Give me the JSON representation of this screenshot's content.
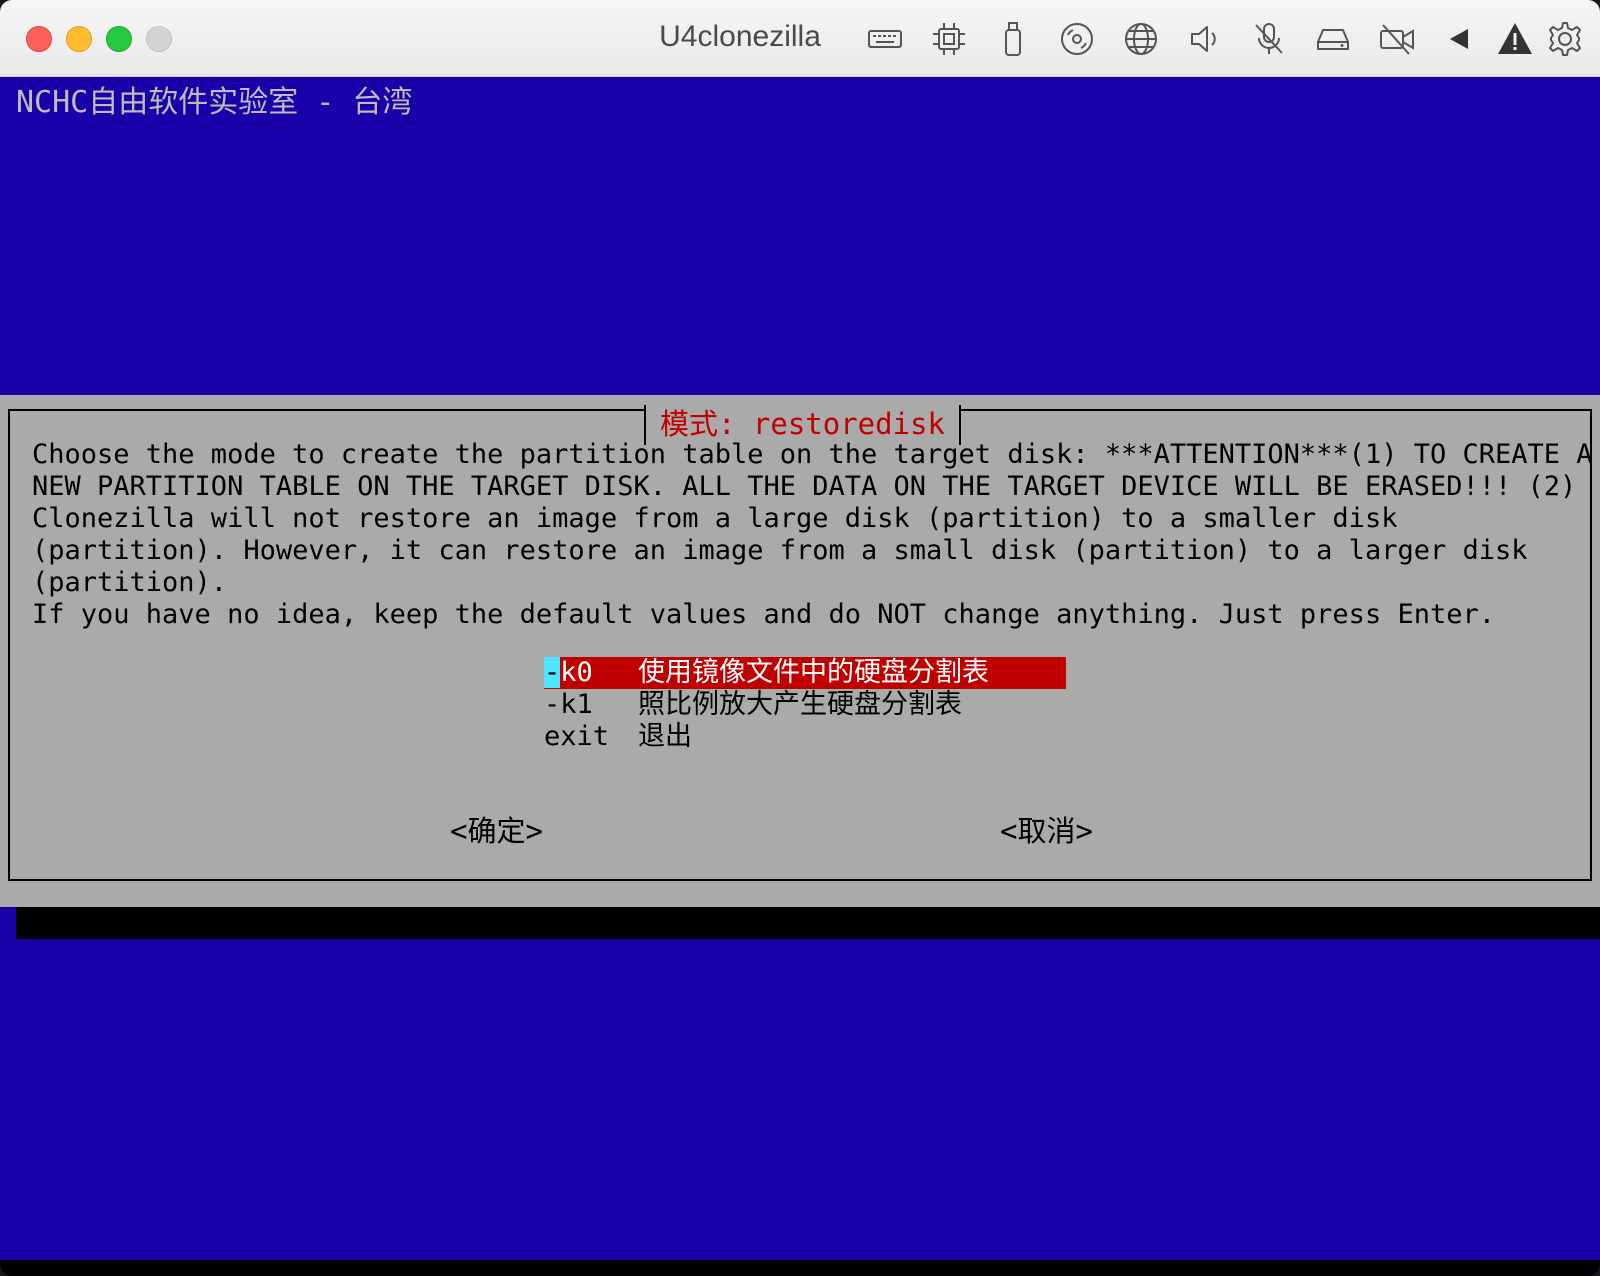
{
  "window": {
    "title": "U4clonezilla",
    "toolbar_icons": [
      "keyboard-icon",
      "cpu-icon",
      "usb-icon",
      "disc-icon",
      "network-icon",
      "speaker-icon",
      "microphone-muted-icon",
      "hard-drive-icon",
      "camera-off-icon",
      "back-arrow-icon",
      "warning-icon",
      "settings-gear-icon"
    ]
  },
  "console": {
    "backtitle": "NCHC自由软件实验室 - 台湾",
    "dialog": {
      "title": "模式: restoredisk",
      "text": "Choose the mode to create the partition table on the target disk: ***ATTENTION***(1) TO CREATE A\nNEW PARTITION TABLE ON THE TARGET DISK. ALL THE DATA ON THE TARGET DEVICE WILL BE ERASED!!! (2)\nClonezilla will not restore an image from a large disk (partition) to a smaller disk\n(partition). However, it can restore an image from a small disk (partition) to a larger disk\n(partition).\nIf you have no idea, keep the default values and do NOT change anything. Just press Enter.",
      "menu": [
        {
          "tag_first": "-",
          "tag_rest": "k0",
          "label": "使用镜像文件中的硬盘分割表",
          "selected": true
        },
        {
          "tag": "-k1",
          "label": "照比例放大产生硬盘分割表",
          "selected": false
        },
        {
          "tag": "exit",
          "label": "退出",
          "selected": false
        }
      ],
      "ok_button": "<确定>",
      "cancel_button": "<取消>"
    }
  },
  "colors": {
    "background_blue": "#1900a8",
    "dialog_gray": "#aaaaaa",
    "title_red": "#c00000",
    "cursor_cyan": "#4fe4ff"
  }
}
